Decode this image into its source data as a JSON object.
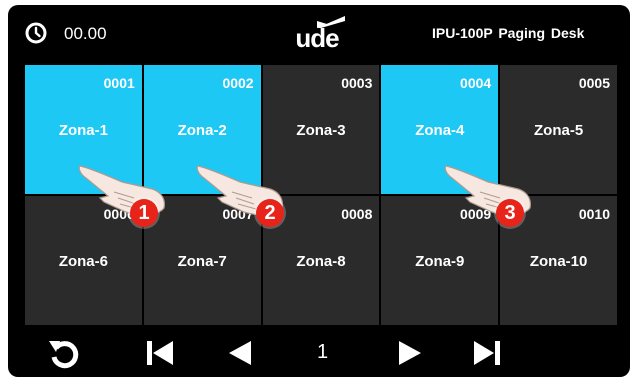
{
  "header": {
    "time": "00.00",
    "logo_text": "ude",
    "device_title": "IPU-100P  Paging Desk"
  },
  "zones": [
    {
      "number": "0001",
      "label": "Zona-1",
      "active": true
    },
    {
      "number": "0002",
      "label": "Zona-2",
      "active": true
    },
    {
      "number": "0003",
      "label": "Zona-3",
      "active": false
    },
    {
      "number": "0004",
      "label": "Zona-4",
      "active": true
    },
    {
      "number": "0005",
      "label": "Zona-5",
      "active": false
    },
    {
      "number": "0006",
      "label": "Zona-6",
      "active": false
    },
    {
      "number": "0007",
      "label": "Zona-7",
      "active": false
    },
    {
      "number": "0008",
      "label": "Zona-8",
      "active": false
    },
    {
      "number": "0009",
      "label": "Zona-9",
      "active": false
    },
    {
      "number": "0010",
      "label": "Zona-10",
      "active": false
    }
  ],
  "footer": {
    "page": "1",
    "buttons": [
      "refresh-icon",
      "skip-first-icon",
      "previous-icon",
      "next-icon",
      "skip-last-icon"
    ]
  },
  "callouts": [
    "1",
    "2",
    "3"
  ],
  "colors": {
    "active_zone": "#1ec8f5",
    "inactive_zone": "#2b2b2b",
    "background": "#000000",
    "callout": "#e8241a"
  }
}
